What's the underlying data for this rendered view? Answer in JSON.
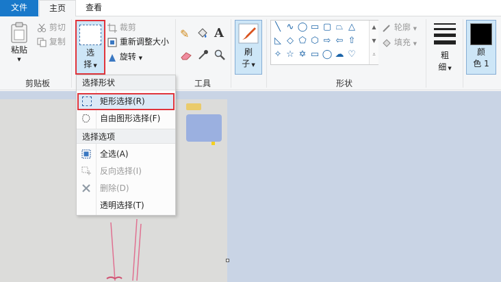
{
  "tabs": {
    "file": "文件",
    "home": "主页",
    "view": "查看"
  },
  "clipboard": {
    "paste": "粘贴",
    "cut": "剪切",
    "copy": "复制",
    "group": "剪贴板"
  },
  "image": {
    "select_line1": "选",
    "select_line2": "择",
    "crop": "裁剪",
    "resize": "重新调整大小",
    "rotate": "旋转"
  },
  "tools": {
    "group": "工具"
  },
  "brushes": {
    "line1": "刷",
    "line2": "子"
  },
  "shapes": {
    "outline": "轮廓",
    "fill": "填充",
    "group": "形状"
  },
  "size": {
    "line1": "粗",
    "line2": "细"
  },
  "color1": {
    "line1": "颜",
    "line2": "色 1"
  },
  "select_menu": {
    "header_shapes": "选择形状",
    "rect": "矩形选择(R)",
    "free": "自由图形选择(F)",
    "header_options": "选择选项",
    "select_all": "全选(A)",
    "invert": "反向选择(I)",
    "delete": "删除(D)",
    "transparent": "透明选择(T)"
  },
  "colors": {
    "accent": "#1979ca",
    "highlight": "#e0333a",
    "workspace": "#c9d4e5"
  }
}
